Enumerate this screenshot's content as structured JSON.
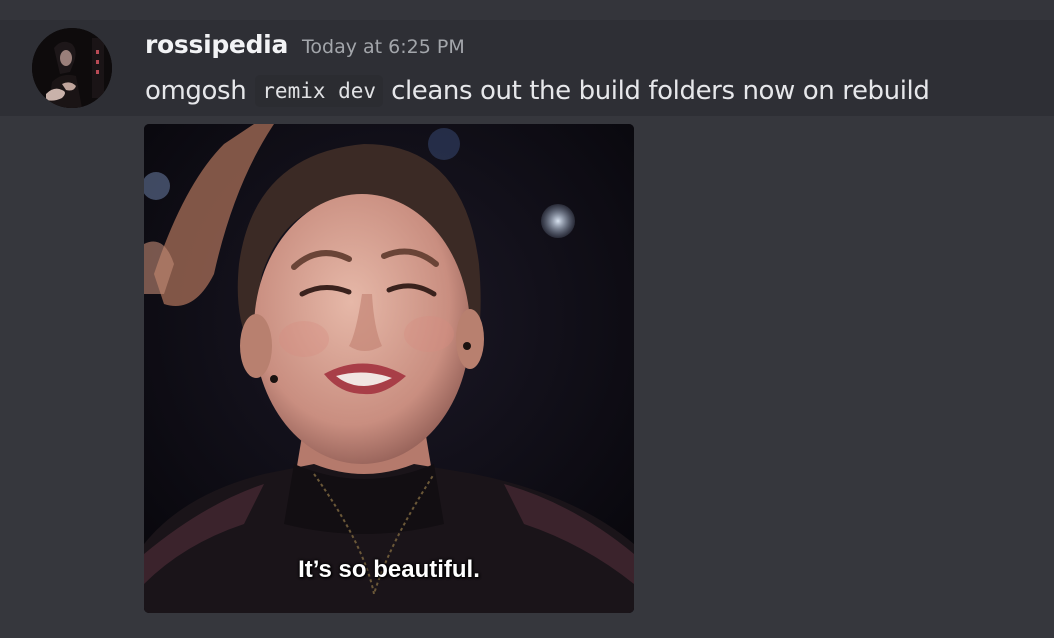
{
  "message": {
    "username": "rossipedia",
    "timestamp": "Today at 6:25 PM",
    "text_before": "omgosh",
    "code": "remix dev",
    "text_after": "cleans out the build folders now on rebuild"
  },
  "attachment": {
    "caption": "It’s so beautiful."
  },
  "colors": {
    "background": "#36373d",
    "message_hover": "#2e2f35",
    "username": "#f2f3f5",
    "timestamp": "#a3a6ab",
    "text": "#e6e7ea",
    "code_bg": "#2b2c31"
  }
}
